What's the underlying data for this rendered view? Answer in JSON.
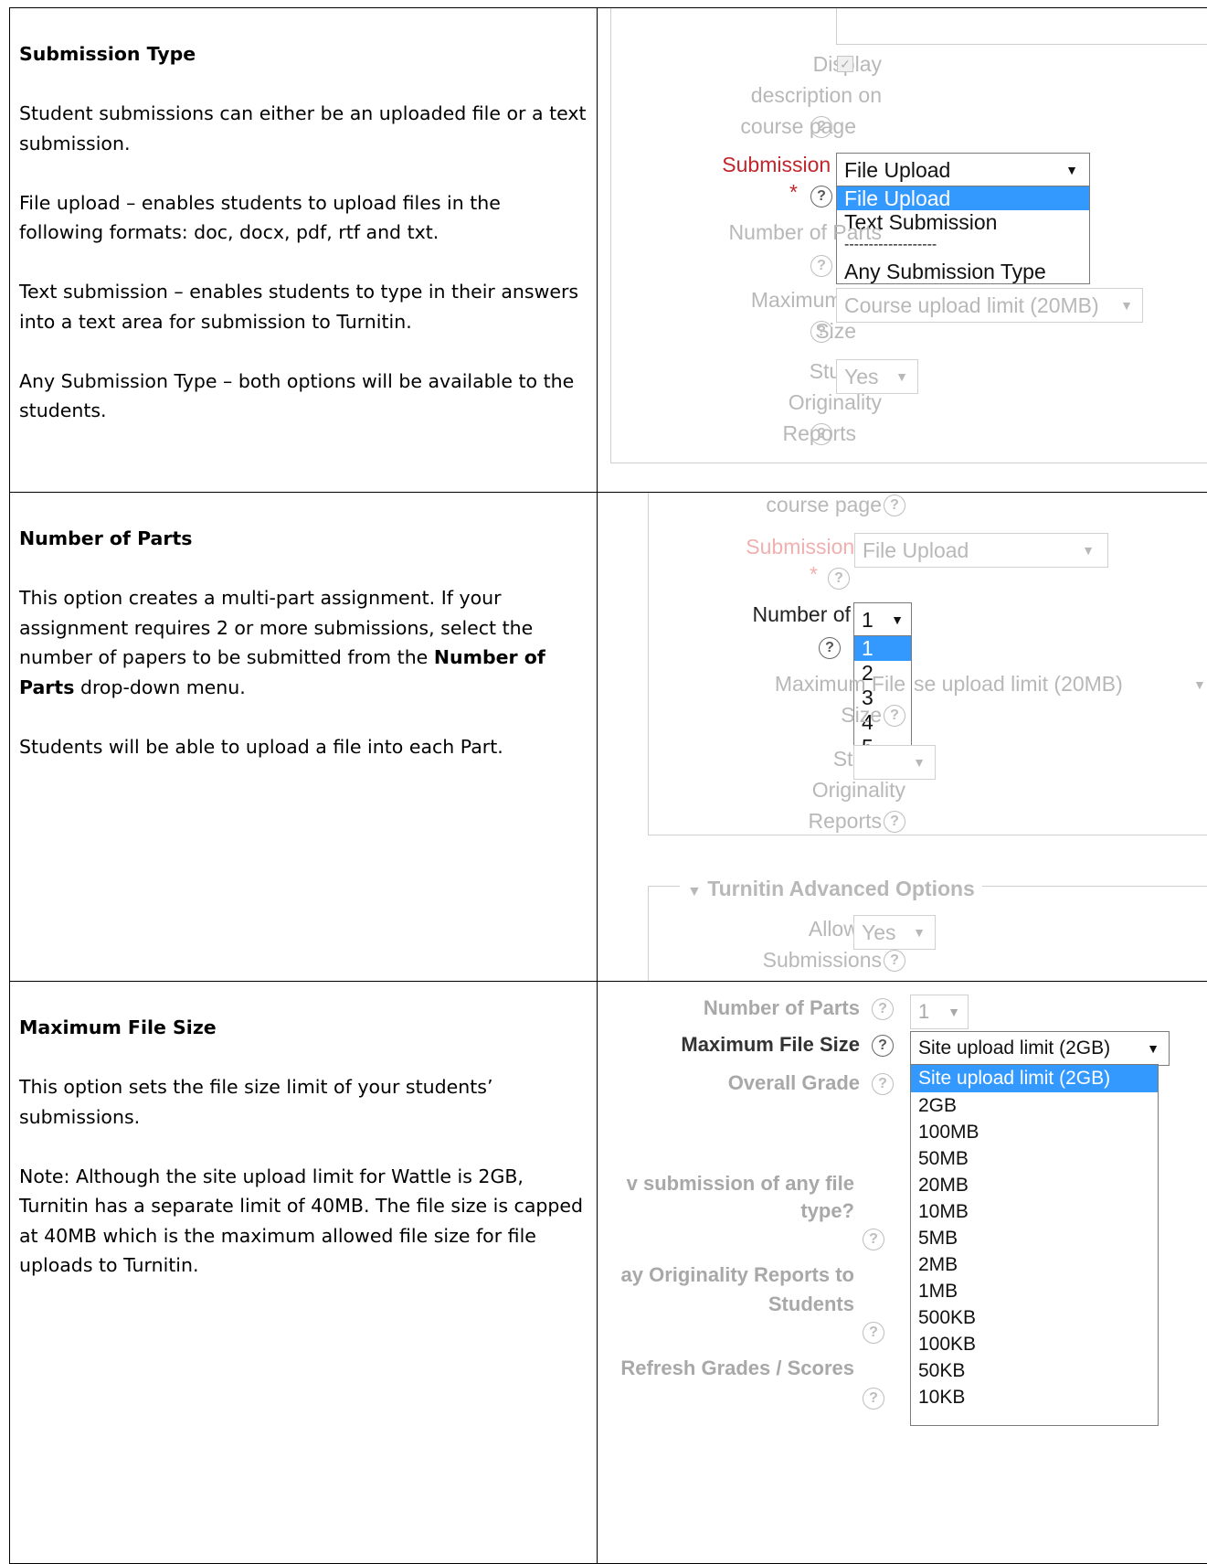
{
  "sections": [
    {
      "heading": "Submission Type",
      "paragraphs": [
        "Student submissions can either be an uploaded file or a text submission.",
        "File upload – enables students to upload files in the following formats: doc, docx, pdf, rtf and txt.",
        "Text submission – enables students to type in their answers into a text area for submission to Turnitin.",
        "Any Submission Type – both options will be available to the students."
      ],
      "shot": {
        "display_label_1": "Display",
        "display_label_2": "description on",
        "display_label_3": "course page",
        "submission_type_label": "Submission Type",
        "required_mark": "*",
        "selected_value": "File Upload",
        "options": [
          "File Upload",
          "Text Submission",
          "-------------------",
          "Any Submission Type"
        ],
        "number_of_parts_label": "Number of Parts",
        "max_file_label_1": "Maximum File",
        "max_file_label_2": "Size",
        "max_file_value": "Course upload limit (20MB)",
        "originality_label_1": "Student",
        "originality_label_2": "Originality",
        "originality_label_3": "Reports",
        "originality_value": "Yes",
        "help_glyph": "?",
        "caret_glyph": "▼"
      }
    },
    {
      "heading": "Number of Parts",
      "para1_before": "This option creates a multi-part assignment. If your assignment requires 2 or more submissions, select the number of papers to be submitted from the ",
      "para1_bold": "Number of Parts",
      "para1_after": " drop-down menu.",
      "para2": "Students will be able to upload a file into each Part.",
      "shot": {
        "course_page_label": "course page",
        "submission_type_label": "Submission Type",
        "submission_type_value": "File Upload",
        "required_mark": "*",
        "number_of_parts_label": "Number of Parts",
        "parts_selected": "1",
        "parts_options": [
          "1",
          "2",
          "3",
          "4",
          "5"
        ],
        "max_file_label_1": "Maximum File",
        "max_file_label_2": "Size",
        "max_file_value_partial": "se upload limit (20MB)",
        "originality_label_1": "Student",
        "originality_label_2": "Originality",
        "originality_label_3": "Reports",
        "advanced_legend": "Turnitin Advanced Options",
        "late_label_1": "Allow Late",
        "late_label_2": "Submissions",
        "late_value": "Yes"
      }
    },
    {
      "heading": "Maximum File Size",
      "paragraphs": [
        "This option sets the file size limit of your students’ submissions.",
        "Note: Although the site upload limit for Wattle is 2GB, Turnitin has a separate limit of 40MB. The file size is capped at 40MB which is the maximum allowed file size for file uploads to Turnitin."
      ],
      "shot": {
        "number_of_parts_label": "Number of Parts",
        "parts_value": "1",
        "max_file_label": "Maximum File Size",
        "max_file_value": "Site upload limit (2GB)",
        "overall_grade_label": "Overall Grade",
        "any_file_label_1": "v submission of any file",
        "any_file_label_2": "type?",
        "originality_label_1": "ay Originality Reports to",
        "originality_label_2": "Students",
        "refresh_label": "Refresh Grades / Scores",
        "size_options": [
          "Site upload limit (2GB)",
          "2GB",
          "100MB",
          "50MB",
          "20MB",
          "10MB",
          "5MB",
          "2MB",
          "1MB",
          "500KB",
          "100KB",
          "50KB",
          "10KB"
        ]
      }
    }
  ]
}
